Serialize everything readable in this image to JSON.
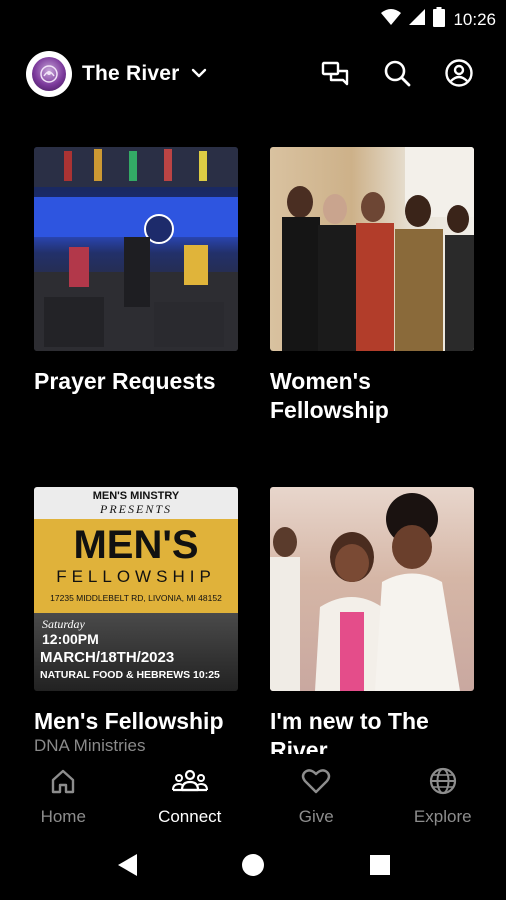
{
  "status_bar": {
    "time": "10:26",
    "icons": [
      "wifi-icon",
      "cell-signal-icon",
      "battery-icon"
    ]
  },
  "header": {
    "church_name": "The River",
    "logo": "the-river-church-logo",
    "actions": [
      "messages-icon",
      "search-icon",
      "account-icon"
    ]
  },
  "cards": [
    {
      "title": "Prayer Requests",
      "subtitle": ""
    },
    {
      "title": "Women's Fellowship",
      "subtitle": ""
    },
    {
      "title": "Men's Fellowship",
      "subtitle": "DNA Ministries",
      "poster": {
        "line1": "MEN'S MINSTRY",
        "line2": "PRESENTS",
        "line3": "MEN'S",
        "line4": "FELLOWSHIP",
        "line5": "17235 MIDDLEBELT RD, LIVONIA, MI 48152",
        "line6": "Saturday",
        "line7": "12:00PM",
        "line8": "MARCH/18TH/2023",
        "line9": "NATURAL FOOD & HEBREWS 10:25"
      }
    },
    {
      "title": "I'm new to The River",
      "subtitle": ""
    }
  ],
  "bottom_nav": [
    {
      "label": "Home",
      "icon": "home-icon",
      "active": false
    },
    {
      "label": "Connect",
      "icon": "group-icon",
      "active": true
    },
    {
      "label": "Give",
      "icon": "heart-icon",
      "active": false
    },
    {
      "label": "Explore",
      "icon": "globe-icon",
      "active": false
    }
  ],
  "colors": {
    "background": "#000000",
    "text_primary": "#ffffff",
    "text_secondary": "#8d8d8d",
    "poster_yellow": "#e0b23a"
  }
}
